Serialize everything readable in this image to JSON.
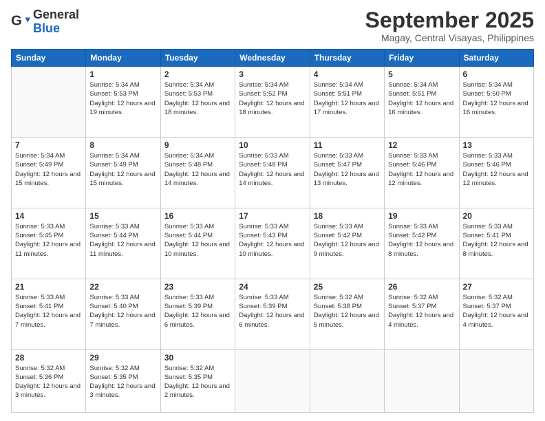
{
  "header": {
    "logo": {
      "general": "General",
      "blue": "Blue"
    },
    "title": "September 2025",
    "location": "Magay, Central Visayas, Philippines"
  },
  "calendar": {
    "days_of_week": [
      "Sunday",
      "Monday",
      "Tuesday",
      "Wednesday",
      "Thursday",
      "Friday",
      "Saturday"
    ],
    "weeks": [
      [
        {
          "day": null
        },
        {
          "day": "1",
          "sunrise": "Sunrise: 5:34 AM",
          "sunset": "Sunset: 5:53 PM",
          "daylight": "Daylight: 12 hours and 19 minutes."
        },
        {
          "day": "2",
          "sunrise": "Sunrise: 5:34 AM",
          "sunset": "Sunset: 5:53 PM",
          "daylight": "Daylight: 12 hours and 18 minutes."
        },
        {
          "day": "3",
          "sunrise": "Sunrise: 5:34 AM",
          "sunset": "Sunset: 5:52 PM",
          "daylight": "Daylight: 12 hours and 18 minutes."
        },
        {
          "day": "4",
          "sunrise": "Sunrise: 5:34 AM",
          "sunset": "Sunset: 5:51 PM",
          "daylight": "Daylight: 12 hours and 17 minutes."
        },
        {
          "day": "5",
          "sunrise": "Sunrise: 5:34 AM",
          "sunset": "Sunset: 5:51 PM",
          "daylight": "Daylight: 12 hours and 16 minutes."
        },
        {
          "day": "6",
          "sunrise": "Sunrise: 5:34 AM",
          "sunset": "Sunset: 5:50 PM",
          "daylight": "Daylight: 12 hours and 16 minutes."
        }
      ],
      [
        {
          "day": "7",
          "sunrise": "Sunrise: 5:34 AM",
          "sunset": "Sunset: 5:49 PM",
          "daylight": "Daylight: 12 hours and 15 minutes."
        },
        {
          "day": "8",
          "sunrise": "Sunrise: 5:34 AM",
          "sunset": "Sunset: 5:49 PM",
          "daylight": "Daylight: 12 hours and 15 minutes."
        },
        {
          "day": "9",
          "sunrise": "Sunrise: 5:34 AM",
          "sunset": "Sunset: 5:48 PM",
          "daylight": "Daylight: 12 hours and 14 minutes."
        },
        {
          "day": "10",
          "sunrise": "Sunrise: 5:33 AM",
          "sunset": "Sunset: 5:48 PM",
          "daylight": "Daylight: 12 hours and 14 minutes."
        },
        {
          "day": "11",
          "sunrise": "Sunrise: 5:33 AM",
          "sunset": "Sunset: 5:47 PM",
          "daylight": "Daylight: 12 hours and 13 minutes."
        },
        {
          "day": "12",
          "sunrise": "Sunrise: 5:33 AM",
          "sunset": "Sunset: 5:46 PM",
          "daylight": "Daylight: 12 hours and 12 minutes."
        },
        {
          "day": "13",
          "sunrise": "Sunrise: 5:33 AM",
          "sunset": "Sunset: 5:46 PM",
          "daylight": "Daylight: 12 hours and 12 minutes."
        }
      ],
      [
        {
          "day": "14",
          "sunrise": "Sunrise: 5:33 AM",
          "sunset": "Sunset: 5:45 PM",
          "daylight": "Daylight: 12 hours and 11 minutes."
        },
        {
          "day": "15",
          "sunrise": "Sunrise: 5:33 AM",
          "sunset": "Sunset: 5:44 PM",
          "daylight": "Daylight: 12 hours and 11 minutes."
        },
        {
          "day": "16",
          "sunrise": "Sunrise: 5:33 AM",
          "sunset": "Sunset: 5:44 PM",
          "daylight": "Daylight: 12 hours and 10 minutes."
        },
        {
          "day": "17",
          "sunrise": "Sunrise: 5:33 AM",
          "sunset": "Sunset: 5:43 PM",
          "daylight": "Daylight: 12 hours and 10 minutes."
        },
        {
          "day": "18",
          "sunrise": "Sunrise: 5:33 AM",
          "sunset": "Sunset: 5:42 PM",
          "daylight": "Daylight: 12 hours and 9 minutes."
        },
        {
          "day": "19",
          "sunrise": "Sunrise: 5:33 AM",
          "sunset": "Sunset: 5:42 PM",
          "daylight": "Daylight: 12 hours and 8 minutes."
        },
        {
          "day": "20",
          "sunrise": "Sunrise: 5:33 AM",
          "sunset": "Sunset: 5:41 PM",
          "daylight": "Daylight: 12 hours and 8 minutes."
        }
      ],
      [
        {
          "day": "21",
          "sunrise": "Sunrise: 5:33 AM",
          "sunset": "Sunset: 5:41 PM",
          "daylight": "Daylight: 12 hours and 7 minutes."
        },
        {
          "day": "22",
          "sunrise": "Sunrise: 5:33 AM",
          "sunset": "Sunset: 5:40 PM",
          "daylight": "Daylight: 12 hours and 7 minutes."
        },
        {
          "day": "23",
          "sunrise": "Sunrise: 5:33 AM",
          "sunset": "Sunset: 5:39 PM",
          "daylight": "Daylight: 12 hours and 6 minutes."
        },
        {
          "day": "24",
          "sunrise": "Sunrise: 5:33 AM",
          "sunset": "Sunset: 5:39 PM",
          "daylight": "Daylight: 12 hours and 6 minutes."
        },
        {
          "day": "25",
          "sunrise": "Sunrise: 5:32 AM",
          "sunset": "Sunset: 5:38 PM",
          "daylight": "Daylight: 12 hours and 5 minutes."
        },
        {
          "day": "26",
          "sunrise": "Sunrise: 5:32 AM",
          "sunset": "Sunset: 5:37 PM",
          "daylight": "Daylight: 12 hours and 4 minutes."
        },
        {
          "day": "27",
          "sunrise": "Sunrise: 5:32 AM",
          "sunset": "Sunset: 5:37 PM",
          "daylight": "Daylight: 12 hours and 4 minutes."
        }
      ],
      [
        {
          "day": "28",
          "sunrise": "Sunrise: 5:32 AM",
          "sunset": "Sunset: 5:36 PM",
          "daylight": "Daylight: 12 hours and 3 minutes."
        },
        {
          "day": "29",
          "sunrise": "Sunrise: 5:32 AM",
          "sunset": "Sunset: 5:35 PM",
          "daylight": "Daylight: 12 hours and 3 minutes."
        },
        {
          "day": "30",
          "sunrise": "Sunrise: 5:32 AM",
          "sunset": "Sunset: 5:35 PM",
          "daylight": "Daylight: 12 hours and 2 minutes."
        },
        {
          "day": null
        },
        {
          "day": null
        },
        {
          "day": null
        },
        {
          "day": null
        }
      ]
    ]
  }
}
